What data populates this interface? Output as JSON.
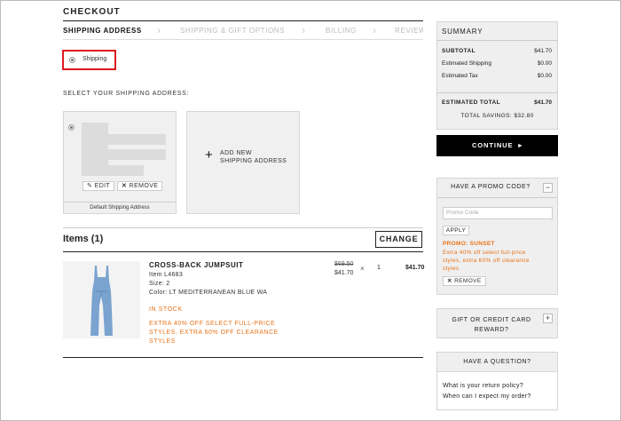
{
  "header": {
    "title": "CHECKOUT",
    "steps": [
      "SHIPPING ADDRESS",
      "SHIPPING & GIFT OPTIONS",
      "BILLING",
      "REVIEW"
    ]
  },
  "shipping_option": {
    "label": "Shipping",
    "selected": true
  },
  "address_section": {
    "label": "SELECT YOUR SHIPPING ADDRESS:",
    "edit_label": "EDIT",
    "remove_label": "REMOVE",
    "default_label": "Default Shipping Address",
    "add_new_line1": "ADD NEW",
    "add_new_line2": "SHIPPING ADDRESS"
  },
  "items": {
    "title": "Items (1)",
    "change_label": "CHANGE",
    "product": {
      "name": "CROSS-BACK JUMPSUIT",
      "item_no": "Item L4683",
      "size": "Size: 2",
      "color": "Color: LT MEDITERRANEAN BLUE WA",
      "stock": "IN STOCK",
      "promo_line1": "EXTRA 40% OFF SELECT FULL-PRICE",
      "promo_line2": "STYLES, EXTRA 60% OFF CLEARANCE",
      "promo_line3": "STYLES",
      "price_original": "$69.50",
      "price_sale": "$41.70",
      "times": "×",
      "quantity": "1",
      "line_total": "$41.70"
    }
  },
  "summary": {
    "title": "SUMMARY",
    "rows": [
      {
        "label": "SUBTOTAL",
        "value": "$41.70"
      },
      {
        "label": "Estimated Shipping",
        "value": "$0.00"
      },
      {
        "label": "Estimated Tax",
        "value": "$0.00"
      }
    ],
    "total_label": "ESTIMATED TOTAL",
    "total_value": "$41.70",
    "savings": "TOTAL SAVINGS: $32.80",
    "continue_label": "CONTINUE"
  },
  "promo_panel": {
    "title": "HAVE A PROMO CODE?",
    "toggle": "−",
    "placeholder": "Promo Code",
    "apply_label": "APPLY",
    "promo_name": "PROMO: SUNSET",
    "promo_desc_1": "Extra 40% off select full-price",
    "promo_desc_2": "styles, extra 60% off clearance",
    "promo_desc_3": "styles",
    "remove_label": "REMOVE"
  },
  "gift_panel": {
    "title_line1": "GIFT OR CREDIT CARD",
    "title_line2": "REWARD?",
    "toggle": "+"
  },
  "question_panel": {
    "title": "HAVE A QUESTION?",
    "q1": "What is your return policy?",
    "q2": "When can I expect my order?"
  },
  "colors": {
    "accent_orange": "#e8731a",
    "highlight_red": "#e0181f",
    "button_black": "#000000"
  }
}
